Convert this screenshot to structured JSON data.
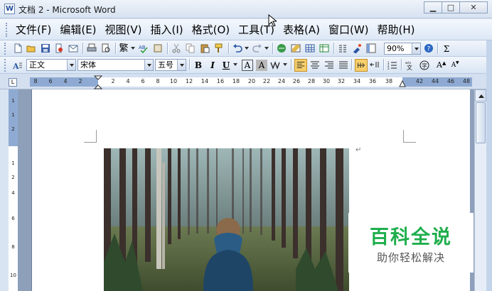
{
  "window": {
    "title": "文档 2 - Microsoft Word",
    "app_icon_glyph": "W"
  },
  "caption_buttons": [
    {
      "name": "minimize-button",
      "glyph": "▁"
    },
    {
      "name": "maximize-button",
      "glyph": "□"
    },
    {
      "name": "close-button",
      "glyph": "✕"
    }
  ],
  "menu": [
    {
      "label": "文件(F)"
    },
    {
      "label": "编辑(E)"
    },
    {
      "label": "视图(V)"
    },
    {
      "label": "插入(I)"
    },
    {
      "label": "格式(O)"
    },
    {
      "label": "工具(T)"
    },
    {
      "label": "表格(A)"
    },
    {
      "label": "窗口(W)"
    },
    {
      "label": "帮助(H)"
    }
  ],
  "standard_toolbar": {
    "traditional_label": "繁",
    "zoom_value": "90%"
  },
  "formatting_toolbar": {
    "style_value": "正文",
    "font_value": "宋体",
    "size_value": "五号",
    "bold": "B",
    "italic": "I",
    "underline": "U",
    "char_border": "A",
    "char_shading": "A",
    "grow_font": "A",
    "shrink_font": "A",
    "alignment_selected": "left"
  },
  "ruler": {
    "left_numbers": [
      "8",
      "6",
      "4",
      "2"
    ],
    "numbers": [
      "2",
      "4",
      "6",
      "8",
      "10",
      "12",
      "14",
      "16",
      "18",
      "20",
      "22",
      "24",
      "26",
      "28",
      "30",
      "32",
      "34",
      "36",
      "38"
    ],
    "right_numbers": [
      "42",
      "44",
      "46",
      "48"
    ],
    "vertical_numbers": [
      "1",
      "1",
      "2",
      "1",
      "2",
      "4",
      "6",
      "8",
      "10"
    ]
  },
  "document": {
    "paragraph_mark": "↵"
  },
  "watermark": {
    "title": "百科全说",
    "subtitle": "助你轻松解决"
  },
  "colors": {
    "watermark_green": "#1fae4c",
    "toolbar_blue": "#d9e5f4"
  }
}
